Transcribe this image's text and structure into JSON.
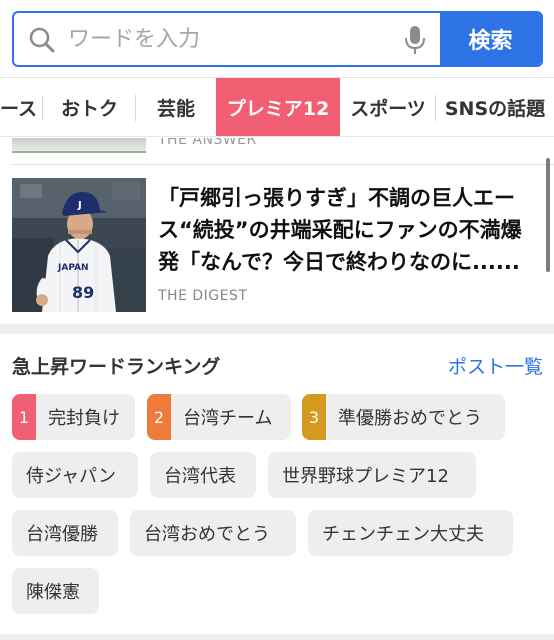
{
  "search": {
    "placeholder": "ワードを入力",
    "button_label": "検索",
    "accent_color": "#2f74e6"
  },
  "tabs": [
    {
      "label": "ース",
      "active": false
    },
    {
      "label": "おトク",
      "active": false
    },
    {
      "label": "芸能",
      "active": false
    },
    {
      "label": "プレミア12",
      "active": true
    },
    {
      "label": "スポーツ",
      "active": false
    },
    {
      "label": "SNSの話題",
      "active": false
    }
  ],
  "news": {
    "previous_source": "THE ANSWER",
    "article": {
      "headline": "「戸郷引っ張りすぎ」不調の巨人エース“続投”の井端采配にファンの不満爆発「なんで？今日で終わりなのに......",
      "source": "THE DIGEST",
      "uniform_text": "JAPAN",
      "uniform_number": "89"
    }
  },
  "ranking": {
    "title": "急上昇ワードランキング",
    "link_label": "ポスト一覧",
    "items": [
      {
        "rank": "1",
        "word": "完封負け",
        "badge_color": "#f25f73"
      },
      {
        "rank": "2",
        "word": "台湾チーム",
        "badge_color": "#ee7a3c"
      },
      {
        "rank": "3",
        "word": "準優勝おめでとう",
        "badge_color": "#d39a1e"
      },
      {
        "rank": "",
        "word": "侍ジャパン"
      },
      {
        "rank": "",
        "word": "台湾代表"
      },
      {
        "rank": "",
        "word": "世界野球プレミア12"
      },
      {
        "rank": "",
        "word": "台湾優勝"
      },
      {
        "rank": "",
        "word": "台湾おめでとう"
      },
      {
        "rank": "",
        "word": "チェンチェン大丈夫"
      },
      {
        "rank": "",
        "word": "陳傑憲"
      }
    ]
  }
}
